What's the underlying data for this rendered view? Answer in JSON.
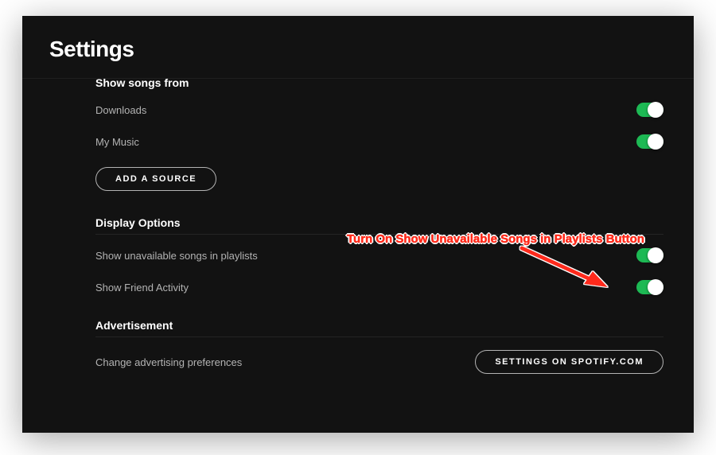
{
  "page": {
    "title": "Settings"
  },
  "sections": {
    "show_songs": {
      "header": "Show songs from",
      "rows": {
        "downloads": {
          "label": "Downloads",
          "on": true
        },
        "my_music": {
          "label": "My Music",
          "on": true
        }
      },
      "add_source_button": "Add a Source"
    },
    "display_options": {
      "header": "Display Options",
      "rows": {
        "unavailable": {
          "label": "Show unavailable songs in playlists",
          "on": true
        },
        "friend_activity": {
          "label": "Show Friend Activity",
          "on": true
        }
      }
    },
    "advertisement": {
      "header": "Advertisement",
      "rows": {
        "change_pref": {
          "label": "Change advertising preferences"
        }
      },
      "spotify_button": "Settings on Spotify.com"
    }
  },
  "annotation": {
    "text": "Turn On Show Unavailable Songs in Playlists Button"
  },
  "colors": {
    "background": "#121212",
    "accent": "#1DB954",
    "text_muted": "#b3b3b3",
    "annotation": "#ff2a1a"
  }
}
